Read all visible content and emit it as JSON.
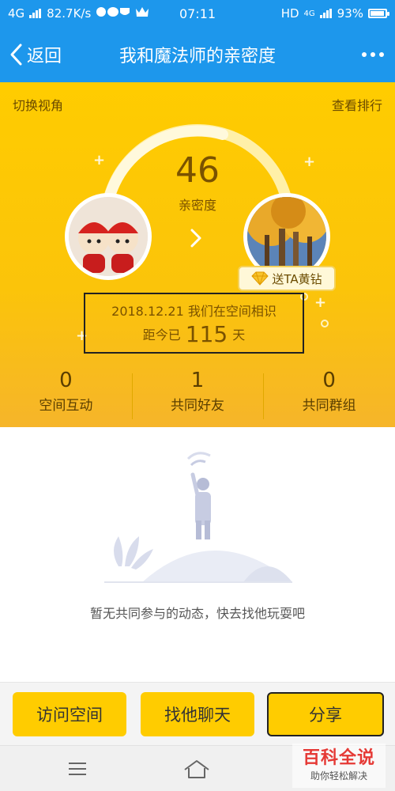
{
  "status_bar": {
    "network": "4G",
    "speed": "82.7K/s",
    "time": "07:11",
    "hd": "HD",
    "network_right": "4G",
    "battery": "93%"
  },
  "header": {
    "back_label": "返回",
    "title": "我和魔法师的亲密度"
  },
  "hero": {
    "switch_view": "切换视角",
    "ranking": "查看排行",
    "score": "46",
    "score_label": "亲密度",
    "gift_label": "送TA黄钻",
    "met_text": "2018.12.21 我们在空间相识",
    "days_prefix": "距今已",
    "days_value": "115",
    "days_suffix": "天"
  },
  "stats": [
    {
      "value": "0",
      "label": "空间互动"
    },
    {
      "value": "1",
      "label": "共同好友"
    },
    {
      "value": "0",
      "label": "共同群组"
    }
  ],
  "empty_state": {
    "text": "暂无共同参与的动态，快去找他玩耍吧"
  },
  "actions": {
    "visit": "访问空间",
    "chat": "找他聊天",
    "share": "分享"
  },
  "watermark": {
    "title": "百科全说",
    "subtitle": "助你轻松解决"
  },
  "colors": {
    "title_bar": "#1d97ec",
    "hero": "#ffcc00",
    "button": "#ffcc00"
  }
}
